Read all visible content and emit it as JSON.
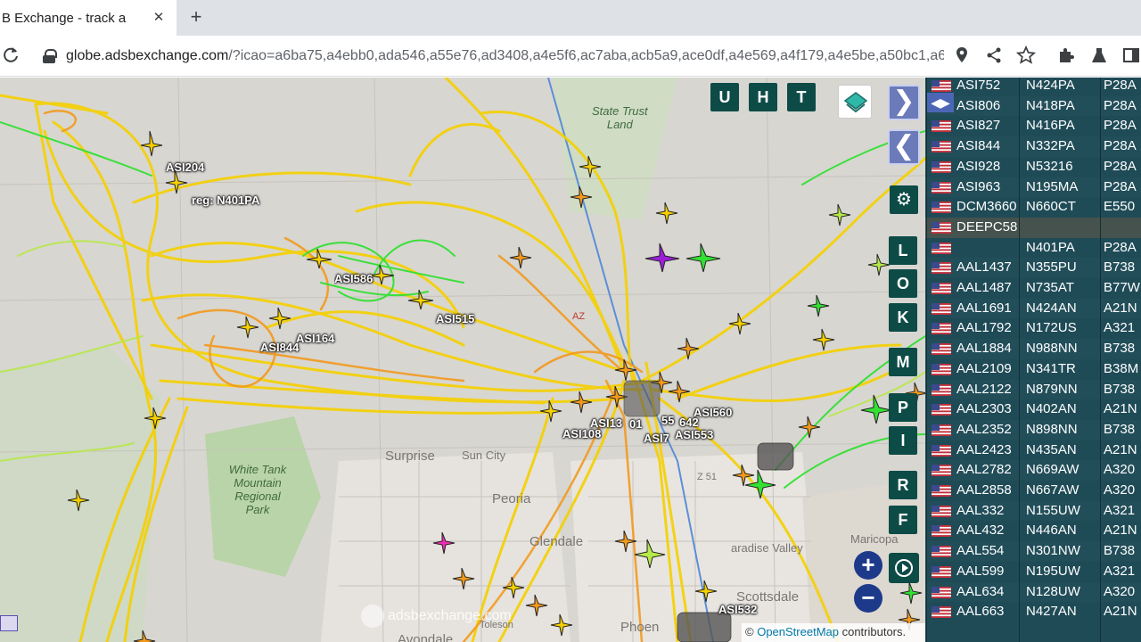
{
  "browser": {
    "tab_title": "B Exchange - track a",
    "tab_close": "✕",
    "new_tab": "+",
    "url_host": "globe.adsbexchange.com",
    "url_rest": "/?icao=a6ba75,a4ebb0,ada546,a55e76,ad3408,a4e5f6,ac7aba,acb5a9,ace0df,a4e569,a4f179,a4e5be,a50bc1,a6..."
  },
  "map": {
    "places": {
      "state_trust": "State Trust\nLand",
      "white_tank": "White Tank\nMountain\nRegional\nPark",
      "surprise": "Surprise",
      "sun_city": "Sun City",
      "peoria": "Peoria",
      "glendale": "Glendale",
      "scottsdale": "Scottsdale",
      "paradise_valley": "aradise Valley",
      "phoenix": "Phoen",
      "avondale": "Avondale",
      "tolleson": "Toleson",
      "maricopa": "Maricopa",
      "az51": "Z 51",
      "az": "AZ"
    },
    "aircraft_labels": {
      "asi204": "ASI204",
      "reg": "reg: N401PA",
      "asi58": "ASI586",
      "asi515": "ASI515",
      "asi164": "ASI164",
      "asi844": "ASI844",
      "asi1": "ASI13",
      "asi108": "ASI108",
      "asi01": "01",
      "asi55": "55",
      "asi642": "642",
      "asi560": "ASI560",
      "asi7": "ASI7",
      "asi553": "ASI553",
      "asi532": "ASI532"
    },
    "buttons": {
      "u": "U",
      "h": "H",
      "t": "T",
      "l": "L",
      "o": "O",
      "k": "K",
      "m": "M",
      "p": "P",
      "i": "I",
      "r": "R",
      "f": "F",
      "next": "❯",
      "prev": "❮",
      "zoom_in": "+",
      "zoom_out": "−"
    },
    "watermark": "adsbexchange.com",
    "attribution_prefix": "© ",
    "attribution_link": "OpenStreetMap",
    "attribution_suffix": " contributors."
  },
  "sidebar": {
    "rows": [
      {
        "callsign": "ASI752",
        "reg": "N424PA",
        "type": "P28A"
      },
      {
        "callsign": "ASI806",
        "reg": "N418PA",
        "type": "P28A"
      },
      {
        "callsign": "ASI827",
        "reg": "N416PA",
        "type": "P28A"
      },
      {
        "callsign": "ASI844",
        "reg": "N332PA",
        "type": "P28A"
      },
      {
        "callsign": "ASI928",
        "reg": "N53216",
        "type": "P28A"
      },
      {
        "callsign": "ASI963",
        "reg": "N195MA",
        "type": "P28A"
      },
      {
        "callsign": "DCM3660",
        "reg": "N660CT",
        "type": "E550"
      },
      {
        "callsign": "DEEPC58",
        "reg": "",
        "type": ""
      },
      {
        "callsign": "",
        "reg": "N401PA",
        "type": "P28A"
      },
      {
        "callsign": "AAL1437",
        "reg": "N355PU",
        "type": "B738"
      },
      {
        "callsign": "AAL1487",
        "reg": "N735AT",
        "type": "B77W"
      },
      {
        "callsign": "AAL1691",
        "reg": "N424AN",
        "type": "A21N"
      },
      {
        "callsign": "AAL1792",
        "reg": "N172US",
        "type": "A321"
      },
      {
        "callsign": "AAL1884",
        "reg": "N988NN",
        "type": "B738"
      },
      {
        "callsign": "AAL2109",
        "reg": "N341TR",
        "type": "B38M"
      },
      {
        "callsign": "AAL2122",
        "reg": "N879NN",
        "type": "B738"
      },
      {
        "callsign": "AAL2303",
        "reg": "N402AN",
        "type": "A21N"
      },
      {
        "callsign": "AAL2352",
        "reg": "N898NN",
        "type": "B738"
      },
      {
        "callsign": "AAL2423",
        "reg": "N435AN",
        "type": "A21N"
      },
      {
        "callsign": "AAL2782",
        "reg": "N669AW",
        "type": "A320"
      },
      {
        "callsign": "AAL2858",
        "reg": "N667AW",
        "type": "A320"
      },
      {
        "callsign": "AAL332",
        "reg": "N155UW",
        "type": "A321"
      },
      {
        "callsign": "AAL432",
        "reg": "N446AN",
        "type": "A21N"
      },
      {
        "callsign": "AAL554",
        "reg": "N301NW",
        "type": "B738"
      },
      {
        "callsign": "AAL599",
        "reg": "N195UW",
        "type": "A321"
      },
      {
        "callsign": "AAL634",
        "reg": "N128UW",
        "type": "A320"
      },
      {
        "callsign": "AAL663",
        "reg": "N427AN",
        "type": "A21N"
      }
    ]
  },
  "colors": {
    "button_bg": "#0d4b47",
    "sidebar_bg": "#1f4b57",
    "track_yellow": "#f5d000",
    "track_orange": "#f29a1e",
    "track_green": "#33e033"
  }
}
